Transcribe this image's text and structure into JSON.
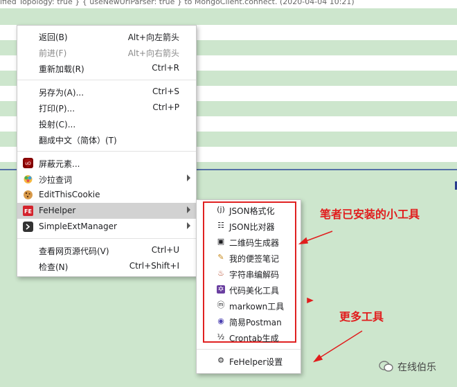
{
  "background": {
    "top_text": "ified Topology: true } { useNewUrlParser: true } to MongoClient.connect. (2020-04-04 10:21)"
  },
  "menu": {
    "items": [
      {
        "label": "返回(B)",
        "shortcut": "Alt+向左箭头",
        "disabled": false
      },
      {
        "label": "前进(F)",
        "shortcut": "Alt+向右箭头",
        "disabled": true
      },
      {
        "label": "重新加载(R)",
        "shortcut": "Ctrl+R",
        "disabled": false
      },
      {
        "label": "另存为(A)...",
        "shortcut": "Ctrl+S",
        "disabled": false
      },
      {
        "label": "打印(P)...",
        "shortcut": "Ctrl+P",
        "disabled": false
      },
      {
        "label": "投射(C)...",
        "shortcut": "",
        "disabled": false
      },
      {
        "label": "翻成中文（简体）(T)",
        "shortcut": "",
        "disabled": false
      },
      {
        "label": "屏蔽元素...",
        "shortcut": "",
        "icon": "ublock-icon"
      },
      {
        "label": "沙拉查词",
        "shortcut": "",
        "icon": "saladict-icon",
        "submenu": true
      },
      {
        "label": "EditThisCookie",
        "shortcut": "",
        "icon": "cookie-icon"
      },
      {
        "label": "FeHelper",
        "shortcut": "",
        "icon": "fehelper-icon",
        "submenu": true,
        "highlighted": true
      },
      {
        "label": "SimpleExtManager",
        "shortcut": "",
        "icon": "extmanager-icon",
        "submenu": true
      },
      {
        "label": "查看网页源代码(V)",
        "shortcut": "Ctrl+U"
      },
      {
        "label": "检查(N)",
        "shortcut": "Ctrl+Shift+I"
      }
    ]
  },
  "submenu": {
    "items": [
      {
        "label": "JSON格式化",
        "icon": "json-format-icon",
        "glyph": "(j)"
      },
      {
        "label": "JSON比对器",
        "icon": "json-compare-icon",
        "glyph": "☷"
      },
      {
        "label": "二维码生成器",
        "icon": "qrcode-icon",
        "glyph": "▣"
      },
      {
        "label": "我的便签笔记",
        "icon": "pencil-icon",
        "glyph": "✎"
      },
      {
        "label": "字符串编解码",
        "icon": "codec-icon",
        "glyph": "♨"
      },
      {
        "label": "代码美化工具",
        "icon": "beautify-icon",
        "glyph": "✡"
      },
      {
        "label": "markown工具",
        "icon": "markdown-icon",
        "glyph": "ⓜ"
      },
      {
        "label": "简易Postman",
        "icon": "postman-icon",
        "glyph": "◉"
      },
      {
        "label": "Crontab生成",
        "icon": "crontab-icon",
        "glyph": "½"
      }
    ],
    "settings_label": "FeHelper设置",
    "settings_glyph": "⚙"
  },
  "annotations": {
    "installed_tools": "笔者已安装的小工具",
    "more_tools": "更多工具"
  },
  "watermark": {
    "text": "在线伯乐"
  },
  "colors": {
    "annotation_red": "#e11d1d",
    "highlight": "#d2d2d2",
    "page_green": "#cde6cd"
  }
}
